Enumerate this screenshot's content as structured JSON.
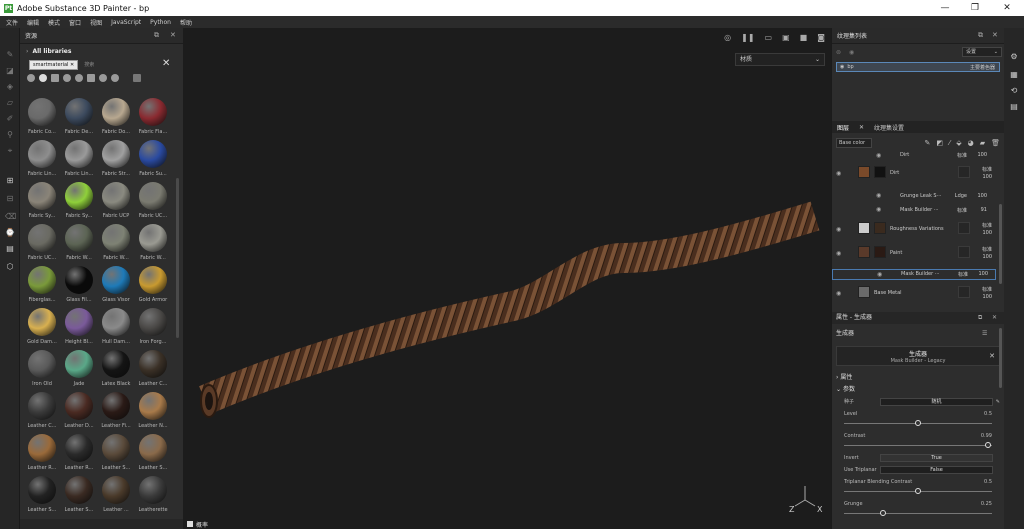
{
  "titlebar": {
    "logo": "Pt",
    "title": "Adobe Substance 3D Painter - bp",
    "min": "—",
    "max": "❐",
    "close": "✕"
  },
  "menu": [
    "文件",
    "编辑",
    "模式",
    "窗口",
    "视图",
    "JavaScript",
    "Python",
    "帮助"
  ],
  "assets": {
    "panel_title": "资源",
    "libraries": "All libraries",
    "search_chip": "smartmaterial",
    "search_placeholder": "搜索",
    "items": [
      {
        "label": "Fabric Co...",
        "color": "#6a6a6a"
      },
      {
        "label": "Fabric De...",
        "color": "#3c4a5e"
      },
      {
        "label": "Fabric Do...",
        "color": "#b8a890"
      },
      {
        "label": "Fabric Fla...",
        "color": "#8a2a30"
      },
      {
        "label": "Fabric Lin...",
        "color": "#8e8e8e"
      },
      {
        "label": "Fabric Lin...",
        "color": "#9a9a9a"
      },
      {
        "label": "Fabric Str...",
        "color": "#a0a0a0"
      },
      {
        "label": "Fabric Su...",
        "color": "#2a4aa0"
      },
      {
        "label": "Fabric Sy...",
        "color": "#8a8478"
      },
      {
        "label": "Fabric Sy...",
        "color": "#8fd03a"
      },
      {
        "label": "Fabric UCP",
        "color": "#8a8a80"
      },
      {
        "label": "Fabric UC...",
        "color": "#7a7a70"
      },
      {
        "label": "Fabric UC...",
        "color": "#6a6a62"
      },
      {
        "label": "Fabric W...",
        "color": "#5c6454"
      },
      {
        "label": "Fabric W...",
        "color": "#7e8274"
      },
      {
        "label": "Fabric W...",
        "color": "#9a9a92"
      },
      {
        "label": "Fiberglas...",
        "color": "#7a9a3a"
      },
      {
        "label": "Glass Fil...",
        "color": "#0a0a0a"
      },
      {
        "label": "Glass Visor",
        "color": "#1e7ab8"
      },
      {
        "label": "Gold Armor",
        "color": "#c89a30"
      },
      {
        "label": "Gold Dam...",
        "color": "#d8b050"
      },
      {
        "label": "Height Bl...",
        "color": "#7a5a9a"
      },
      {
        "label": "Hull Dam...",
        "color": "#8a8a8a"
      },
      {
        "label": "Iron Forg...",
        "color": "#4a4846"
      },
      {
        "label": "Iron Old",
        "color": "#5a5a5a"
      },
      {
        "label": "Jade",
        "color": "#5aa888"
      },
      {
        "label": "Latex Black",
        "color": "#141414"
      },
      {
        "label": "Leather C...",
        "color": "#3a3026"
      },
      {
        "label": "Leather C...",
        "color": "#3a3a3a"
      },
      {
        "label": "Leather D...",
        "color": "#4a2a22"
      },
      {
        "label": "Leather Fi...",
        "color": "#2a1a16"
      },
      {
        "label": "Leather N...",
        "color": "#a87a4a"
      },
      {
        "label": "Leather R...",
        "color": "#9a6a3a"
      },
      {
        "label": "Leather R...",
        "color": "#2a2a2a"
      },
      {
        "label": "Leather S...",
        "color": "#5a4a3a"
      },
      {
        "label": "Leather S...",
        "color": "#8a6a4a"
      },
      {
        "label": "Leather S...",
        "color": "#222222"
      },
      {
        "label": "Leather S...",
        "color": "#3a2a22"
      },
      {
        "label": "Leather ...",
        "color": "#4a3a2a"
      },
      {
        "label": "Leatherette",
        "color": "#3a3a3a"
      }
    ]
  },
  "viewport": {
    "material_select": "材质",
    "footer_label": "概率"
  },
  "texture_sets": {
    "panel_title": "纹理集列表",
    "settings_label": "设置",
    "item_name": "bp",
    "item_shader": "主要着色器"
  },
  "layers": {
    "tab_layers": "图层",
    "tab_settings": "纹理集设置",
    "blend_channel": "Base color",
    "rows": [
      {
        "name": "Dirt",
        "blend": "标准",
        "opacity": "100"
      },
      {
        "name": "Dirt",
        "blend": "标准",
        "opacity": "100"
      },
      {
        "name": "Grunge Leak S···",
        "blend": "Ldge",
        "opacity": "100"
      },
      {
        "name": "Mask Builder ···",
        "blend": "标准",
        "opacity": "91"
      },
      {
        "name": "Roughness Variations",
        "blend": "标准",
        "opacity": "100"
      },
      {
        "name": "Paint",
        "blend": "标准",
        "opacity": "100"
      },
      {
        "name": "Mask Builder ···",
        "blend": "标准",
        "opacity": "100"
      },
      {
        "name": "Base Metal",
        "blend": "标准",
        "opacity": "100"
      }
    ]
  },
  "properties": {
    "panel_title": "属性 - 生成器",
    "section_generator": "生成器",
    "gen_title": "生成器",
    "gen_name": "Mask Builder - Legacy",
    "section_attr": "属性",
    "section_params": "参数",
    "seed_label": "种子",
    "seed_value": "随机",
    "level_label": "Level",
    "level_value": "0.5",
    "level_frac": 0.5,
    "contrast_label": "Contrast",
    "contrast_value": "0.99",
    "contrast_frac": 0.99,
    "invert_label": "Invert",
    "invert_value": "True",
    "triplanar_label": "Use Triplanar",
    "triplanar_value": "False",
    "blend_label": "Triplanar Blending Contrast",
    "blend_value": "0.5",
    "blend_frac": 0.5,
    "grunge_label": "Grunge",
    "grunge_value": "0.25",
    "grunge_frac": 0.25
  }
}
